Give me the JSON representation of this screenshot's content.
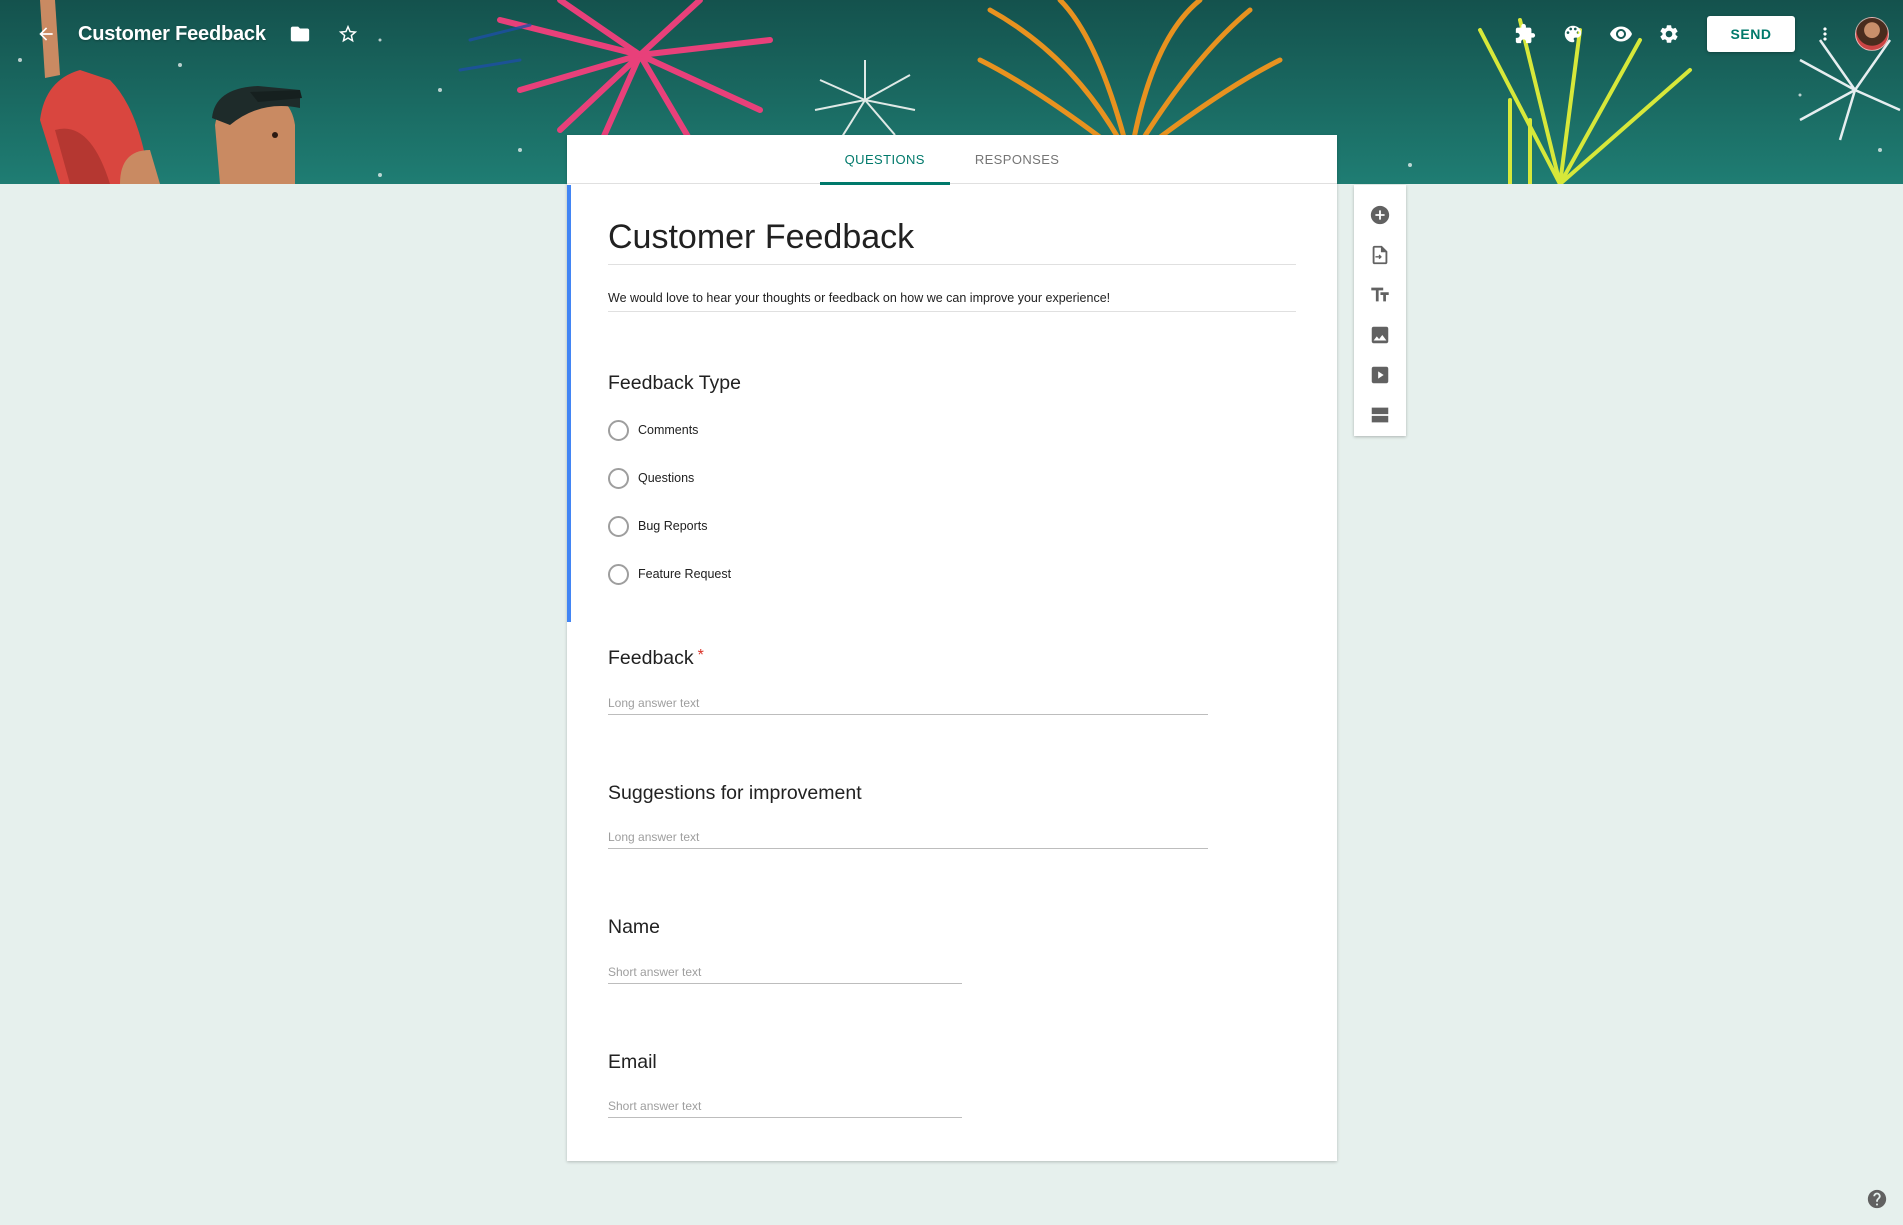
{
  "header": {
    "title": "Customer Feedback",
    "send_label": "SEND",
    "icons": [
      "back-arrow-icon",
      "folder-icon",
      "star-icon",
      "addons-puzzle-icon",
      "palette-icon",
      "preview-eye-icon",
      "settings-gear-icon",
      "more-vert-icon"
    ]
  },
  "tabs": [
    {
      "label": "QUESTIONS",
      "active": true
    },
    {
      "label": "RESPONSES",
      "active": false
    }
  ],
  "form": {
    "title": "Customer Feedback",
    "description": "We would love to hear your thoughts or feedback on how we can improve your experience!",
    "questions": [
      {
        "title": "Feedback Type",
        "type": "multiple_choice",
        "options": [
          "Comments",
          "Questions",
          "Bug Reports",
          "Feature Request"
        ]
      },
      {
        "title": "Feedback",
        "required_mark": "*",
        "type": "paragraph",
        "placeholder": "Long answer text"
      },
      {
        "title": "Suggestions for improvement",
        "type": "paragraph",
        "placeholder": "Long answer text"
      },
      {
        "title": "Name",
        "type": "short",
        "placeholder": "Short answer text"
      },
      {
        "title": "Email",
        "type": "short",
        "placeholder": "Short answer text"
      }
    ]
  },
  "toolbar": {
    "items": [
      "add-question-icon",
      "import-questions-icon",
      "add-title-icon",
      "add-image-icon",
      "add-video-icon",
      "add-section-icon"
    ]
  },
  "colors": {
    "accent": "#00796b",
    "focus_bar": "#4285f4",
    "required": "#d93025",
    "background": "#e6f0ed"
  }
}
